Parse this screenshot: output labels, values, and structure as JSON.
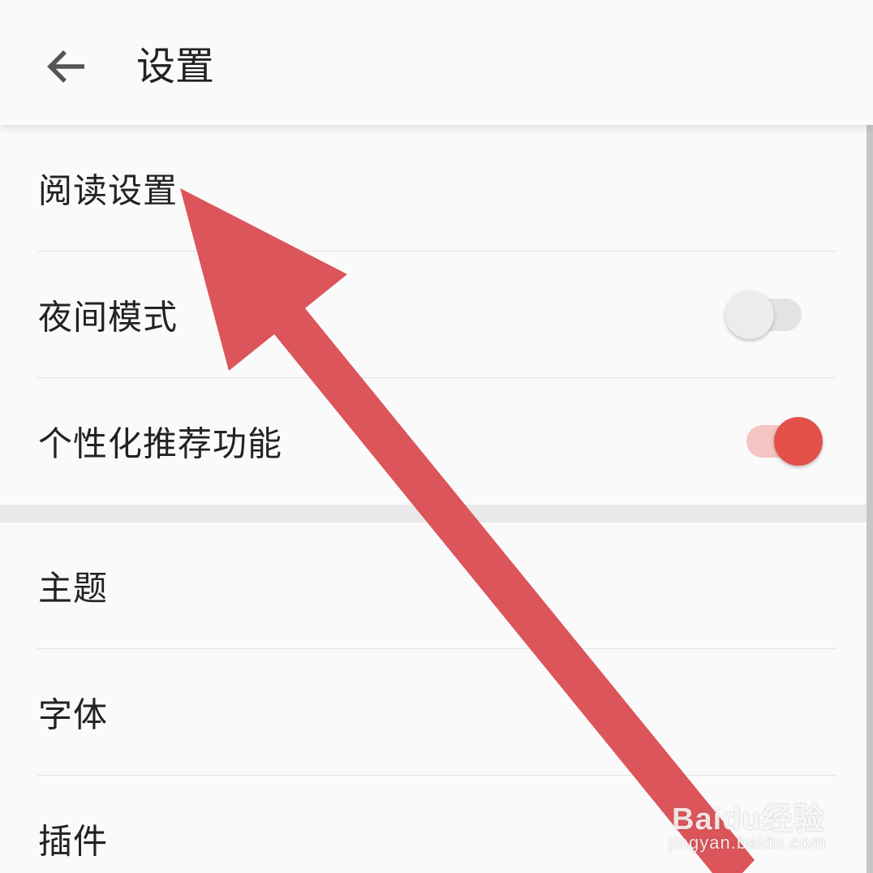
{
  "header": {
    "title": "设置",
    "back_icon": "arrow-left-icon"
  },
  "settings": {
    "reading_settings": "阅读设置",
    "night_mode": {
      "label": "夜间模式",
      "enabled": false
    },
    "personalized_recommendation": {
      "label": "个性化推荐功能",
      "enabled": true
    },
    "theme": "主题",
    "font": "字体",
    "plugins": "插件"
  },
  "colors": {
    "accent": "#e3504a",
    "accent_track": "#f3c4c2",
    "annotation_arrow": "#db555b"
  },
  "watermark": {
    "brand": "Bai",
    "brand_suffix": "du",
    "brand_cn": "经验",
    "url": "jingyan.baidu.com"
  }
}
